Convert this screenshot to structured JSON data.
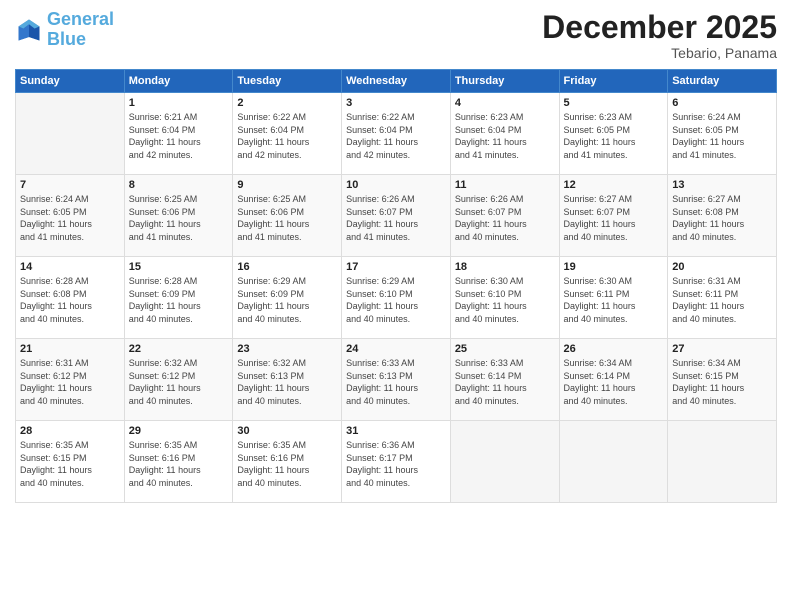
{
  "logo": {
    "line1": "General",
    "line2": "Blue"
  },
  "title": "December 2025",
  "subtitle": "Tebario, Panama",
  "days_header": [
    "Sunday",
    "Monday",
    "Tuesday",
    "Wednesday",
    "Thursday",
    "Friday",
    "Saturday"
  ],
  "weeks": [
    [
      {
        "num": "",
        "info": ""
      },
      {
        "num": "1",
        "info": "Sunrise: 6:21 AM\nSunset: 6:04 PM\nDaylight: 11 hours\nand 42 minutes."
      },
      {
        "num": "2",
        "info": "Sunrise: 6:22 AM\nSunset: 6:04 PM\nDaylight: 11 hours\nand 42 minutes."
      },
      {
        "num": "3",
        "info": "Sunrise: 6:22 AM\nSunset: 6:04 PM\nDaylight: 11 hours\nand 42 minutes."
      },
      {
        "num": "4",
        "info": "Sunrise: 6:23 AM\nSunset: 6:04 PM\nDaylight: 11 hours\nand 41 minutes."
      },
      {
        "num": "5",
        "info": "Sunrise: 6:23 AM\nSunset: 6:05 PM\nDaylight: 11 hours\nand 41 minutes."
      },
      {
        "num": "6",
        "info": "Sunrise: 6:24 AM\nSunset: 6:05 PM\nDaylight: 11 hours\nand 41 minutes."
      }
    ],
    [
      {
        "num": "7",
        "info": "Sunrise: 6:24 AM\nSunset: 6:05 PM\nDaylight: 11 hours\nand 41 minutes."
      },
      {
        "num": "8",
        "info": "Sunrise: 6:25 AM\nSunset: 6:06 PM\nDaylight: 11 hours\nand 41 minutes."
      },
      {
        "num": "9",
        "info": "Sunrise: 6:25 AM\nSunset: 6:06 PM\nDaylight: 11 hours\nand 41 minutes."
      },
      {
        "num": "10",
        "info": "Sunrise: 6:26 AM\nSunset: 6:07 PM\nDaylight: 11 hours\nand 41 minutes."
      },
      {
        "num": "11",
        "info": "Sunrise: 6:26 AM\nSunset: 6:07 PM\nDaylight: 11 hours\nand 40 minutes."
      },
      {
        "num": "12",
        "info": "Sunrise: 6:27 AM\nSunset: 6:07 PM\nDaylight: 11 hours\nand 40 minutes."
      },
      {
        "num": "13",
        "info": "Sunrise: 6:27 AM\nSunset: 6:08 PM\nDaylight: 11 hours\nand 40 minutes."
      }
    ],
    [
      {
        "num": "14",
        "info": "Sunrise: 6:28 AM\nSunset: 6:08 PM\nDaylight: 11 hours\nand 40 minutes."
      },
      {
        "num": "15",
        "info": "Sunrise: 6:28 AM\nSunset: 6:09 PM\nDaylight: 11 hours\nand 40 minutes."
      },
      {
        "num": "16",
        "info": "Sunrise: 6:29 AM\nSunset: 6:09 PM\nDaylight: 11 hours\nand 40 minutes."
      },
      {
        "num": "17",
        "info": "Sunrise: 6:29 AM\nSunset: 6:10 PM\nDaylight: 11 hours\nand 40 minutes."
      },
      {
        "num": "18",
        "info": "Sunrise: 6:30 AM\nSunset: 6:10 PM\nDaylight: 11 hours\nand 40 minutes."
      },
      {
        "num": "19",
        "info": "Sunrise: 6:30 AM\nSunset: 6:11 PM\nDaylight: 11 hours\nand 40 minutes."
      },
      {
        "num": "20",
        "info": "Sunrise: 6:31 AM\nSunset: 6:11 PM\nDaylight: 11 hours\nand 40 minutes."
      }
    ],
    [
      {
        "num": "21",
        "info": "Sunrise: 6:31 AM\nSunset: 6:12 PM\nDaylight: 11 hours\nand 40 minutes."
      },
      {
        "num": "22",
        "info": "Sunrise: 6:32 AM\nSunset: 6:12 PM\nDaylight: 11 hours\nand 40 minutes."
      },
      {
        "num": "23",
        "info": "Sunrise: 6:32 AM\nSunset: 6:13 PM\nDaylight: 11 hours\nand 40 minutes."
      },
      {
        "num": "24",
        "info": "Sunrise: 6:33 AM\nSunset: 6:13 PM\nDaylight: 11 hours\nand 40 minutes."
      },
      {
        "num": "25",
        "info": "Sunrise: 6:33 AM\nSunset: 6:14 PM\nDaylight: 11 hours\nand 40 minutes."
      },
      {
        "num": "26",
        "info": "Sunrise: 6:34 AM\nSunset: 6:14 PM\nDaylight: 11 hours\nand 40 minutes."
      },
      {
        "num": "27",
        "info": "Sunrise: 6:34 AM\nSunset: 6:15 PM\nDaylight: 11 hours\nand 40 minutes."
      }
    ],
    [
      {
        "num": "28",
        "info": "Sunrise: 6:35 AM\nSunset: 6:15 PM\nDaylight: 11 hours\nand 40 minutes."
      },
      {
        "num": "29",
        "info": "Sunrise: 6:35 AM\nSunset: 6:16 PM\nDaylight: 11 hours\nand 40 minutes."
      },
      {
        "num": "30",
        "info": "Sunrise: 6:35 AM\nSunset: 6:16 PM\nDaylight: 11 hours\nand 40 minutes."
      },
      {
        "num": "31",
        "info": "Sunrise: 6:36 AM\nSunset: 6:17 PM\nDaylight: 11 hours\nand 40 minutes."
      },
      {
        "num": "",
        "info": ""
      },
      {
        "num": "",
        "info": ""
      },
      {
        "num": "",
        "info": ""
      }
    ]
  ]
}
